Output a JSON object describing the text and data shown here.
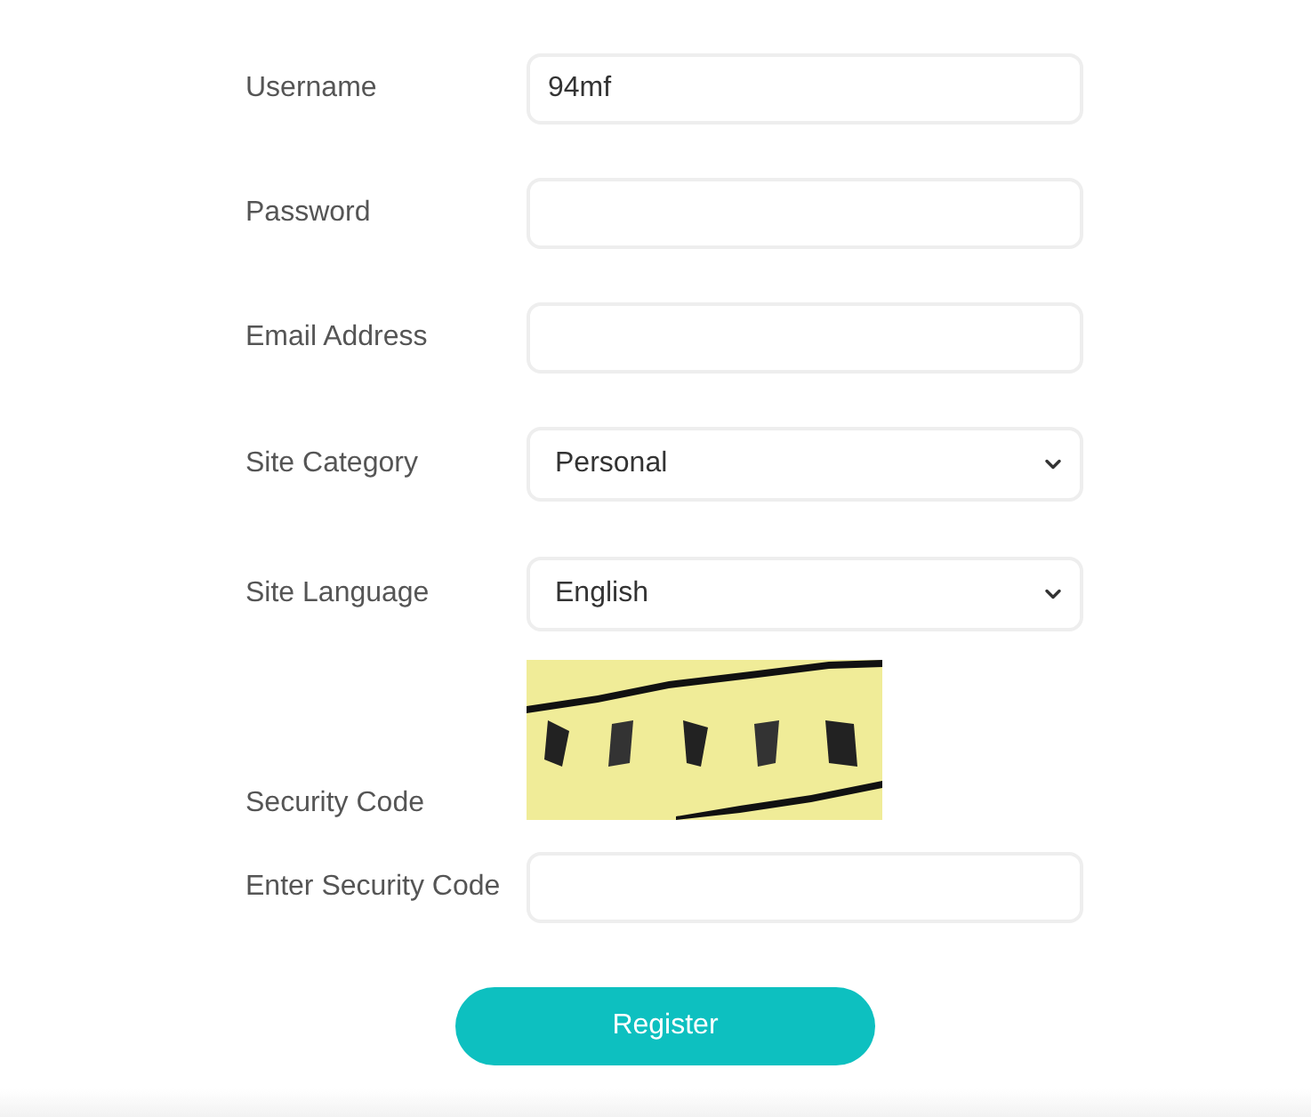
{
  "fields": [
    {
      "kind": "text",
      "label": "Username",
      "value": "94mf"
    },
    {
      "kind": "password",
      "label": "Password"
    },
    {
      "kind": "text",
      "label": "Email Address"
    },
    {
      "kind": "select",
      "label": "Site Category",
      "value": "Personal"
    },
    {
      "kind": "select",
      "label": "Site Language",
      "value": "English"
    },
    {
      "kind": "captcha",
      "label": "Security Code"
    },
    {
      "kind": "text",
      "label": "Enter Security Code"
    }
  ],
  "submit": "Register"
}
